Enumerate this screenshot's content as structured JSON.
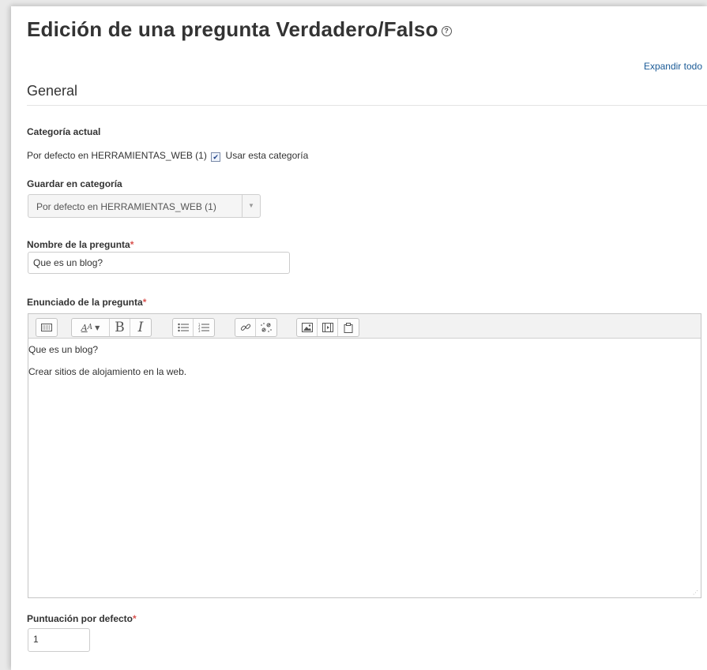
{
  "page": {
    "title": "Edición de una pregunta Verdadero/Falso",
    "help_icon": "question-circle-icon",
    "expand_all": "Expandir todo"
  },
  "general": {
    "title": "General",
    "current_category_label": "Categoría actual",
    "current_category_value": "Por defecto en HERRAMIENTAS_WEB (1)",
    "use_category_checked": true,
    "use_category_label": "Usar esta categoría",
    "save_category_label": "Guardar en categoría",
    "save_category_value": "Por defecto en HERRAMIENTAS_WEB (1)",
    "question_name_label": "Nombre de la pregunta",
    "question_name_value": "Que es un blog?",
    "question_text_label": "Enunciado de la pregunta",
    "question_text_lines": [
      "Que es un blog?",
      "Crear sitios de alojamiento en la web."
    ],
    "default_mark_label": "Puntuación por defecto",
    "default_mark_value": "1",
    "required_marker": "*"
  },
  "editor_toolbar": {
    "groups": [
      [
        "toggle-toolbar-icon"
      ],
      [
        "font-style-icon",
        "bold-icon",
        "italic-icon"
      ],
      [
        "unordered-list-icon",
        "ordered-list-icon"
      ],
      [
        "link-icon",
        "unlink-icon"
      ],
      [
        "image-icon",
        "media-icon",
        "file-manager-icon"
      ]
    ]
  },
  "colors": {
    "link": "#1a5a96",
    "required": "#d9534f",
    "toolbar_bg": "#f2f2f2"
  }
}
